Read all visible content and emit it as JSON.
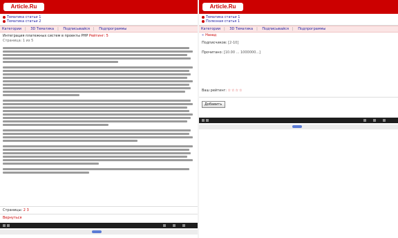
{
  "colors": {
    "brand_red": "#cc0000",
    "link_blue": "#1a1aa0",
    "cat_bg": "#fbe5e5",
    "player_bg": "#1e1e1e"
  },
  "left": {
    "logo": "Article.Ru",
    "nav_links": [
      "Тематика статьи 1",
      "Тематика статьи 2"
    ],
    "categories": [
      "Категории",
      "ЗD Тематика",
      "Подписывайся",
      "Подпрограммы"
    ],
    "article_title": "Интеграция платежных систем в проекты PHP",
    "rating_text": "Рейтинг: 5",
    "page_label": "Страница: 1 из 5",
    "pages_label": "Страницы:",
    "pages_numbers": "2 3",
    "back_link": "Вернуться"
  },
  "right": {
    "logo": "Article.Ru",
    "nav_links": [
      "Тематика статьи 1",
      "Полезная статья 1"
    ],
    "categories": [
      "Категории",
      "ЗD Тематика",
      "Подписывайся",
      "Подпрограммы"
    ],
    "back_label": "Назад",
    "fields": [
      {
        "label": "Подписчиков:",
        "value": "[2-10]"
      },
      {
        "label": "Прочитано:",
        "value": "[10.00 ... 1000000...]"
      }
    ],
    "rating_label": "Ваш рейтинг:",
    "rating_stars": "☆☆☆☆",
    "rate_button": "Добавить"
  }
}
